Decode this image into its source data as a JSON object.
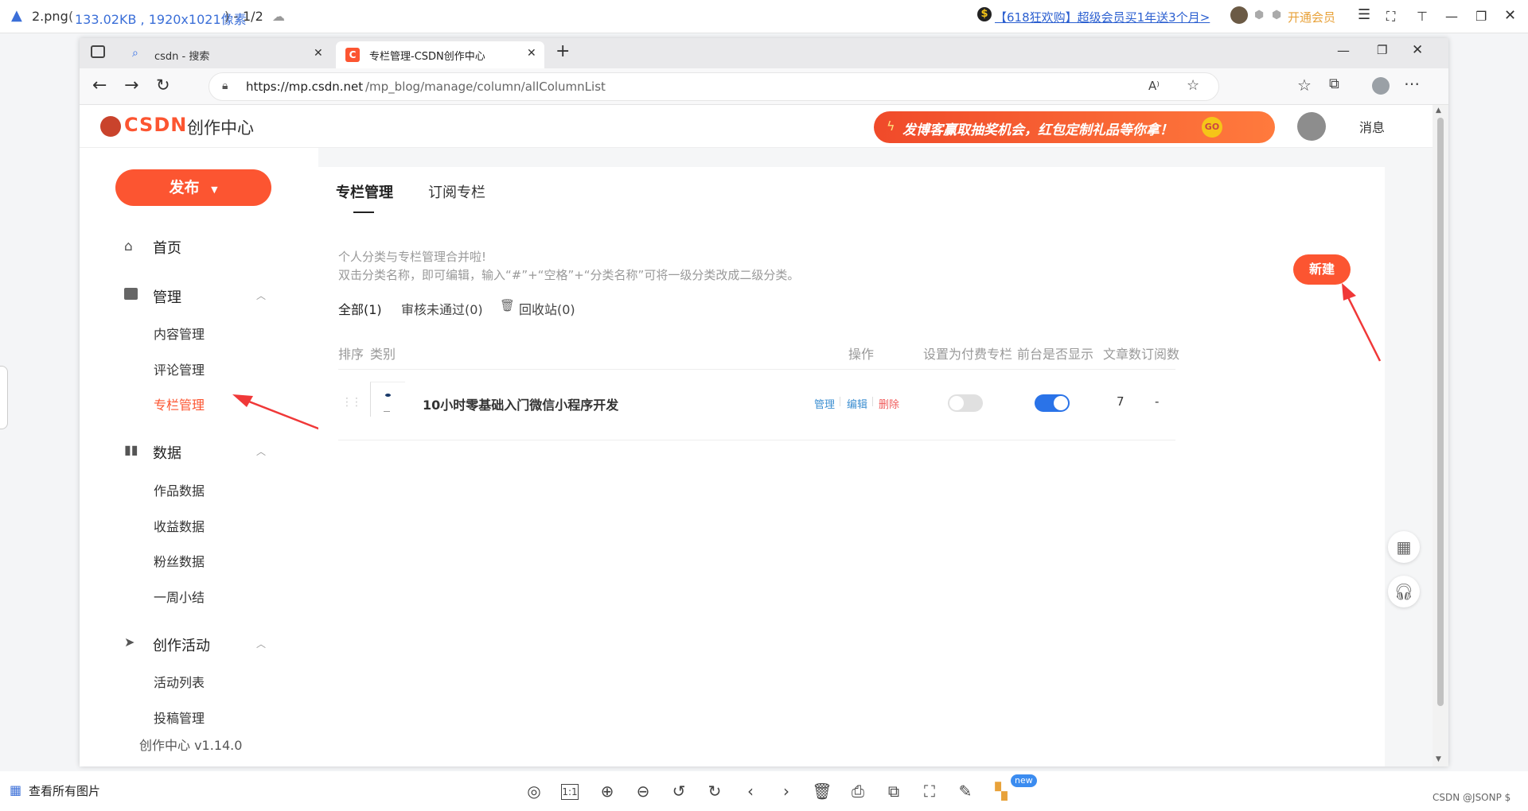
{
  "viewer": {
    "file_name": "2.png",
    "file_info": "133.02KB , 1920x1021像素",
    "page_indicator": "1/2",
    "promo_text": "【618狂欢购】超级会员买1年送3个月>",
    "vip_label": "开通会员",
    "view_all_label": "查看所有图片",
    "new_badge": "new",
    "watermark": "CSDN @JSONP $"
  },
  "browser": {
    "tabs": [
      {
        "title": "csdn - 搜索",
        "icon": "search-icon"
      },
      {
        "title": "专栏管理-CSDN创作中心",
        "icon": "csdn-logo-icon"
      }
    ],
    "url_host": "https://mp.csdn.net",
    "url_path": "/mp_blog/manage/column/allColumnList"
  },
  "csdn": {
    "logo_text": "CSDN",
    "center_title": "创作中心",
    "banner_text": "发博客赢取抽奖机会，红包定制礼品等你拿！",
    "banner_go": "GO",
    "messages_label": "消息",
    "publish_label": "发布",
    "version": "创作中心 v1.14.0",
    "sidebar": {
      "home": "首页",
      "manage": "管理",
      "manage_items": [
        "内容管理",
        "评论管理",
        "专栏管理"
      ],
      "data": "数据",
      "data_items": [
        "作品数据",
        "收益数据",
        "粉丝数据",
        "一周小结"
      ],
      "activity": "创作活动",
      "activity_items": [
        "活动列表",
        "投稿管理"
      ]
    },
    "main": {
      "tabs": [
        "专栏管理",
        "订阅专栏"
      ],
      "notice_line1": "个人分类与专栏管理合并啦!",
      "notice_line2": "双击分类名称，即可编辑，输入“#”+“空格”+“分类名称”可将一级分类改成二级分类。",
      "new_button": "新建",
      "filters": [
        "全部(1)",
        "审核未通过(0)",
        "回收站(0)"
      ],
      "columns": [
        "排序",
        "类别",
        "操作",
        "设置为付费专栏",
        "前台是否显示",
        "文章数",
        "订阅数"
      ],
      "rows": [
        {
          "title": "10小时零基础入门微信小程序开发",
          "actions": [
            "管理",
            "编辑",
            "删除"
          ],
          "paid": false,
          "visible": true,
          "articles": "7",
          "subscribers": "-"
        }
      ]
    }
  },
  "colors": {
    "brand_red": "#fc5531",
    "toggle_on": "#2a73e8",
    "link_blue": "#3d8fd1",
    "delete_red": "#f05b5b"
  }
}
